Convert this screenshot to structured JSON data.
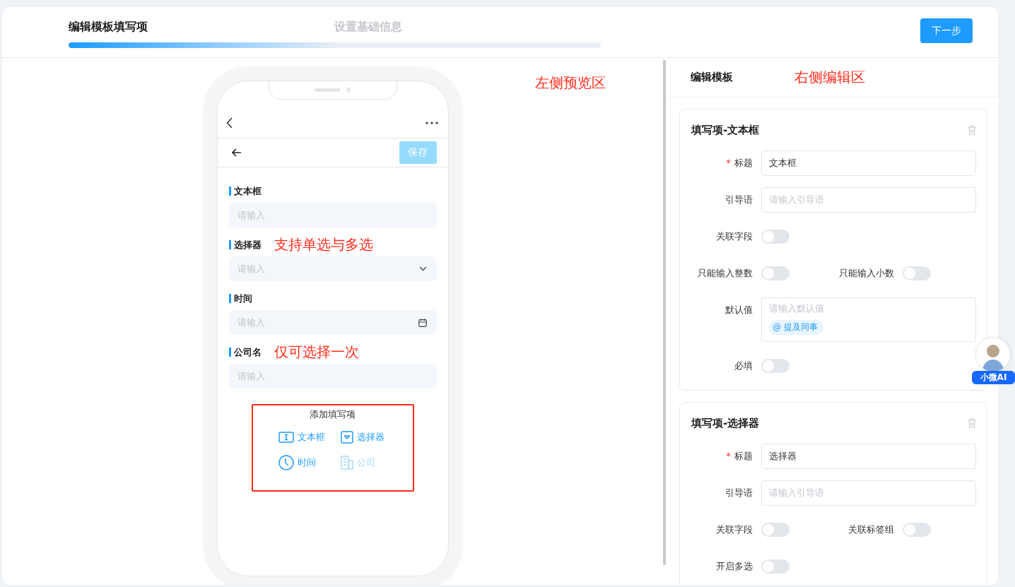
{
  "steps": [
    {
      "label": "编辑模板填写项",
      "selected": true
    },
    {
      "label": "设置基础信息",
      "selected": false
    }
  ],
  "progress": {
    "level": 0.5
  },
  "next_button": "下一步",
  "preview": {
    "annotation": "左侧预览区",
    "save_button": "保存",
    "save_disabled": true,
    "fields": [
      {
        "label": "文本框",
        "placeholder": "请输入",
        "kind": "text"
      },
      {
        "label": "选择器",
        "placeholder": "请输入",
        "kind": "select",
        "note": "支持单选与多选"
      },
      {
        "label": "时间",
        "placeholder": "请输入",
        "kind": "date"
      },
      {
        "label": "公司名",
        "placeholder": "请输入",
        "kind": "text",
        "note": "仅可选择一次"
      }
    ],
    "add_panel": {
      "title": "添加填写项",
      "items": [
        {
          "label": "文本框",
          "kind": "text",
          "disabled": false
        },
        {
          "label": "选择器",
          "kind": "select",
          "disabled": false
        },
        {
          "label": "时间",
          "kind": "time",
          "disabled": false
        },
        {
          "label": "公司",
          "kind": "company",
          "disabled": true
        }
      ]
    }
  },
  "editor": {
    "title": "编辑模板",
    "annotation": "右侧编辑区",
    "cards": [
      {
        "title": "填写项-文本框",
        "rows": [
          {
            "kind": "input",
            "label": "标题",
            "required": true,
            "value": "文本框"
          },
          {
            "kind": "input",
            "label": "引导语",
            "required": false,
            "placeholder": "请输入引导语"
          },
          {
            "kind": "switches",
            "switches": [
              {
                "label": "关联字段",
                "on": false
              }
            ]
          },
          {
            "kind": "switches",
            "switches": [
              {
                "label": "只能输入整数",
                "on": false
              },
              {
                "label": "只能输入小数",
                "on": false
              }
            ]
          },
          {
            "kind": "textarea",
            "label": "默认值",
            "placeholder": "请输入默认值",
            "mention": "@ 提及同事"
          },
          {
            "kind": "switches",
            "switches": [
              {
                "label": "必填",
                "on": false
              }
            ]
          }
        ]
      },
      {
        "title": "填写项-选择器",
        "rows": [
          {
            "kind": "input",
            "label": "标题",
            "required": true,
            "value": "选择器"
          },
          {
            "kind": "input",
            "label": "引导语",
            "required": false,
            "placeholder": "请输入引导语"
          },
          {
            "kind": "switches",
            "switches": [
              {
                "label": "关联字段",
                "on": false
              },
              {
                "label": "关联标签组",
                "on": false
              }
            ]
          },
          {
            "kind": "switches",
            "switches": [
              {
                "label": "开启多选",
                "on": false
              }
            ]
          }
        ]
      }
    ]
  },
  "assistant": {
    "label": "小微AI"
  }
}
